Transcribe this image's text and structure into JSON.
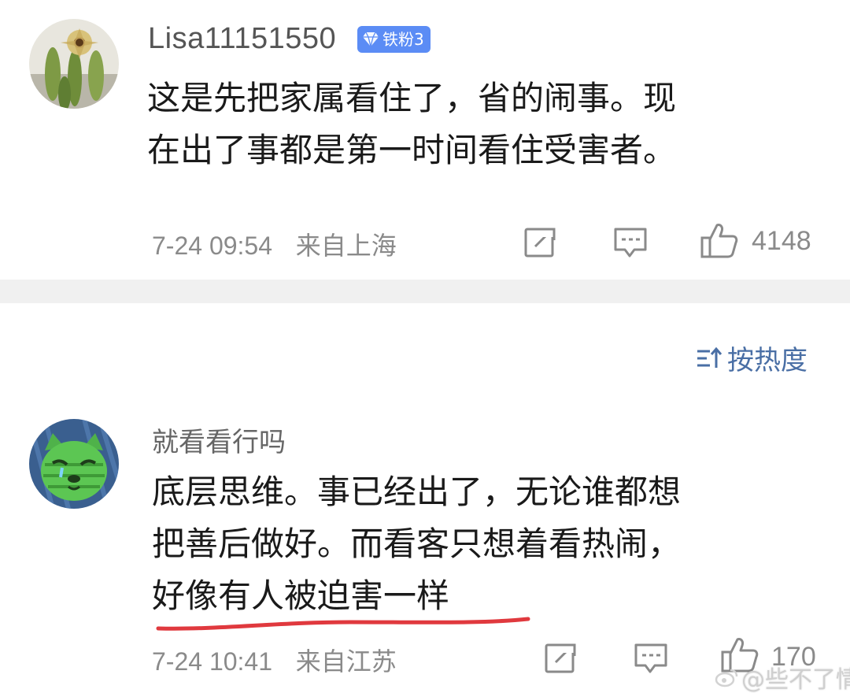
{
  "comments": [
    {
      "username": "Lisa11151550",
      "badge": "铁粉3",
      "lines": [
        "这是先把家属看住了，省的闹事。现",
        "在出了事都是第一时间看住受害者。"
      ],
      "time": "7-24 09:54",
      "location": "来自上海",
      "likes": "4148"
    },
    {
      "username": "就看看行吗",
      "lines": [
        "底层思维。事已经出了，无论谁都想",
        "把善后做好。而看客只想着看热闹，",
        "好像有人被迫害一样"
      ],
      "time": "7-24 10:41",
      "location": "来自江苏",
      "likes": "170"
    }
  ],
  "sort": {
    "label": "按热度"
  },
  "watermark": {
    "text": "@些不了情"
  },
  "colors": {
    "badge_bg": "#5b8cf5",
    "link": "#4a6fa5",
    "underline": "#e0393e",
    "divider": "#f0f0f0"
  },
  "icons": [
    "repost-icon",
    "comment-icon",
    "like-icon",
    "sort-icon",
    "gem-icon",
    "weibo-logo-icon"
  ]
}
